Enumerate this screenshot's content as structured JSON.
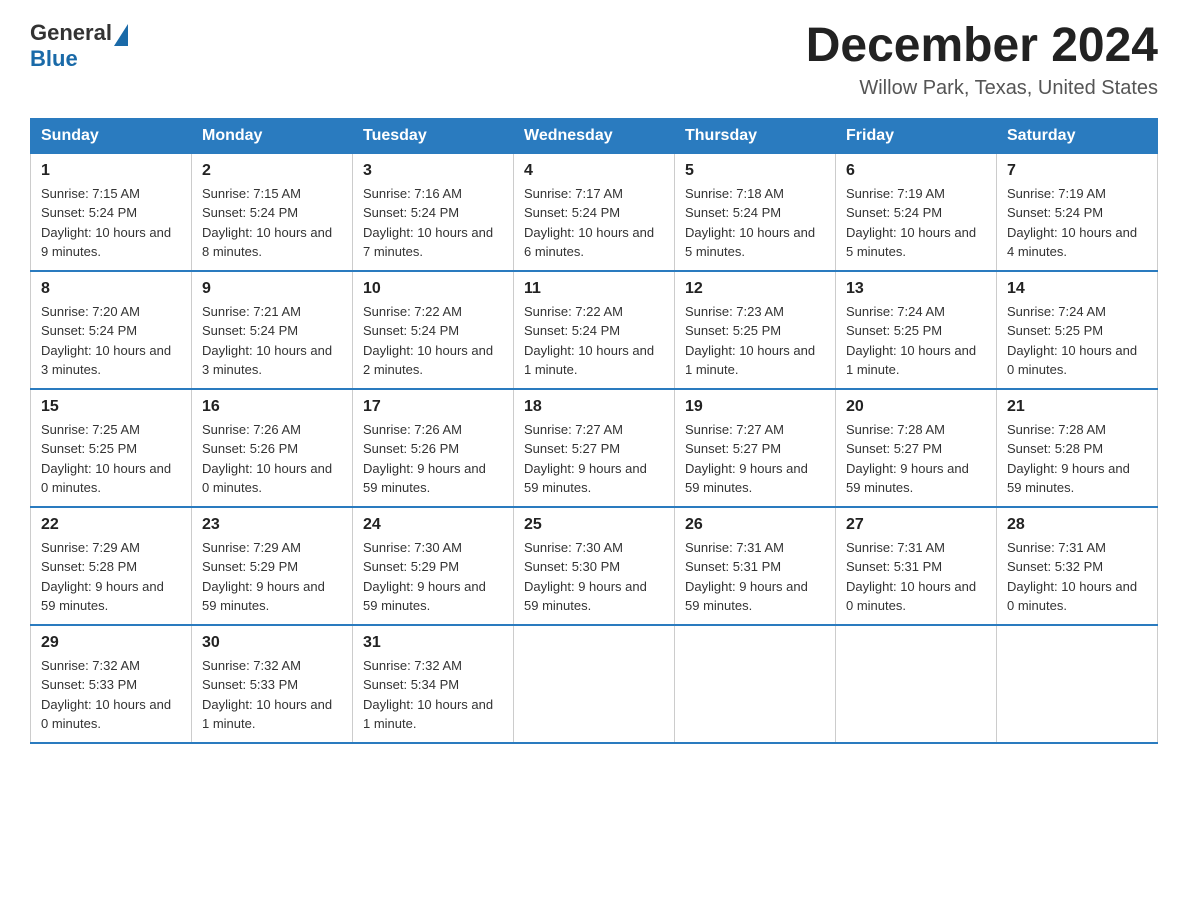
{
  "header": {
    "logo_general": "General",
    "logo_blue": "Blue",
    "title": "December 2024",
    "location": "Willow Park, Texas, United States"
  },
  "days_of_week": [
    "Sunday",
    "Monday",
    "Tuesday",
    "Wednesday",
    "Thursday",
    "Friday",
    "Saturday"
  ],
  "weeks": [
    [
      {
        "day": "1",
        "sunrise": "7:15 AM",
        "sunset": "5:24 PM",
        "daylight": "10 hours and 9 minutes."
      },
      {
        "day": "2",
        "sunrise": "7:15 AM",
        "sunset": "5:24 PM",
        "daylight": "10 hours and 8 minutes."
      },
      {
        "day": "3",
        "sunrise": "7:16 AM",
        "sunset": "5:24 PM",
        "daylight": "10 hours and 7 minutes."
      },
      {
        "day": "4",
        "sunrise": "7:17 AM",
        "sunset": "5:24 PM",
        "daylight": "10 hours and 6 minutes."
      },
      {
        "day": "5",
        "sunrise": "7:18 AM",
        "sunset": "5:24 PM",
        "daylight": "10 hours and 5 minutes."
      },
      {
        "day": "6",
        "sunrise": "7:19 AM",
        "sunset": "5:24 PM",
        "daylight": "10 hours and 5 minutes."
      },
      {
        "day": "7",
        "sunrise": "7:19 AM",
        "sunset": "5:24 PM",
        "daylight": "10 hours and 4 minutes."
      }
    ],
    [
      {
        "day": "8",
        "sunrise": "7:20 AM",
        "sunset": "5:24 PM",
        "daylight": "10 hours and 3 minutes."
      },
      {
        "day": "9",
        "sunrise": "7:21 AM",
        "sunset": "5:24 PM",
        "daylight": "10 hours and 3 minutes."
      },
      {
        "day": "10",
        "sunrise": "7:22 AM",
        "sunset": "5:24 PM",
        "daylight": "10 hours and 2 minutes."
      },
      {
        "day": "11",
        "sunrise": "7:22 AM",
        "sunset": "5:24 PM",
        "daylight": "10 hours and 1 minute."
      },
      {
        "day": "12",
        "sunrise": "7:23 AM",
        "sunset": "5:25 PM",
        "daylight": "10 hours and 1 minute."
      },
      {
        "day": "13",
        "sunrise": "7:24 AM",
        "sunset": "5:25 PM",
        "daylight": "10 hours and 1 minute."
      },
      {
        "day": "14",
        "sunrise": "7:24 AM",
        "sunset": "5:25 PM",
        "daylight": "10 hours and 0 minutes."
      }
    ],
    [
      {
        "day": "15",
        "sunrise": "7:25 AM",
        "sunset": "5:25 PM",
        "daylight": "10 hours and 0 minutes."
      },
      {
        "day": "16",
        "sunrise": "7:26 AM",
        "sunset": "5:26 PM",
        "daylight": "10 hours and 0 minutes."
      },
      {
        "day": "17",
        "sunrise": "7:26 AM",
        "sunset": "5:26 PM",
        "daylight": "9 hours and 59 minutes."
      },
      {
        "day": "18",
        "sunrise": "7:27 AM",
        "sunset": "5:27 PM",
        "daylight": "9 hours and 59 minutes."
      },
      {
        "day": "19",
        "sunrise": "7:27 AM",
        "sunset": "5:27 PM",
        "daylight": "9 hours and 59 minutes."
      },
      {
        "day": "20",
        "sunrise": "7:28 AM",
        "sunset": "5:27 PM",
        "daylight": "9 hours and 59 minutes."
      },
      {
        "day": "21",
        "sunrise": "7:28 AM",
        "sunset": "5:28 PM",
        "daylight": "9 hours and 59 minutes."
      }
    ],
    [
      {
        "day": "22",
        "sunrise": "7:29 AM",
        "sunset": "5:28 PM",
        "daylight": "9 hours and 59 minutes."
      },
      {
        "day": "23",
        "sunrise": "7:29 AM",
        "sunset": "5:29 PM",
        "daylight": "9 hours and 59 minutes."
      },
      {
        "day": "24",
        "sunrise": "7:30 AM",
        "sunset": "5:29 PM",
        "daylight": "9 hours and 59 minutes."
      },
      {
        "day": "25",
        "sunrise": "7:30 AM",
        "sunset": "5:30 PM",
        "daylight": "9 hours and 59 minutes."
      },
      {
        "day": "26",
        "sunrise": "7:31 AM",
        "sunset": "5:31 PM",
        "daylight": "9 hours and 59 minutes."
      },
      {
        "day": "27",
        "sunrise": "7:31 AM",
        "sunset": "5:31 PM",
        "daylight": "10 hours and 0 minutes."
      },
      {
        "day": "28",
        "sunrise": "7:31 AM",
        "sunset": "5:32 PM",
        "daylight": "10 hours and 0 minutes."
      }
    ],
    [
      {
        "day": "29",
        "sunrise": "7:32 AM",
        "sunset": "5:33 PM",
        "daylight": "10 hours and 0 minutes."
      },
      {
        "day": "30",
        "sunrise": "7:32 AM",
        "sunset": "5:33 PM",
        "daylight": "10 hours and 1 minute."
      },
      {
        "day": "31",
        "sunrise": "7:32 AM",
        "sunset": "5:34 PM",
        "daylight": "10 hours and 1 minute."
      },
      null,
      null,
      null,
      null
    ]
  ],
  "labels": {
    "sunrise": "Sunrise:",
    "sunset": "Sunset:",
    "daylight": "Daylight:"
  }
}
